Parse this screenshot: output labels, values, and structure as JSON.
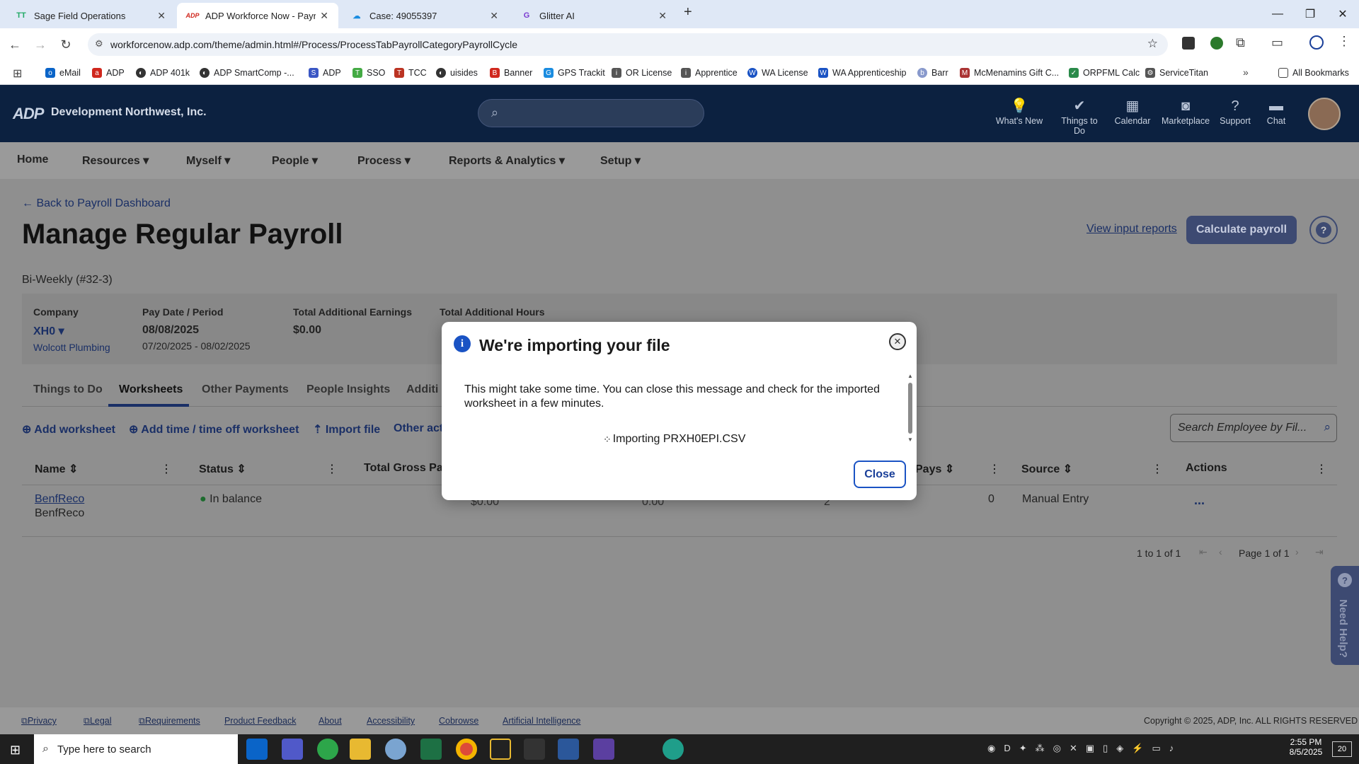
{
  "browser": {
    "tabs": [
      {
        "title": "Sage Field Operations",
        "icon": "TT"
      },
      {
        "title": "ADP Workforce Now - Payroll D",
        "icon": "ADP"
      },
      {
        "title": "Case: 49055397",
        "icon": "cloud"
      },
      {
        "title": "Glitter AI",
        "icon": "G"
      }
    ],
    "url": "workforcenow.adp.com/theme/admin.html#/Process/ProcessTabPayrollCategoryPayrollCycle",
    "bookmarks": [
      "eMail",
      "ADP",
      "ADP 401k",
      "ADP SmartComp -...",
      "ADP",
      "SSO",
      "TCC",
      "uisides",
      "Banner",
      "GPS Trackit",
      "OR License",
      "Apprentice",
      "WA License",
      "WA Apprenticeship",
      "Barr",
      "McMenamins Gift C...",
      "ORPFML Calc",
      "ServiceTitan"
    ],
    "all_bookmarks": "All Bookmarks"
  },
  "header": {
    "logo": "ADP",
    "org": "Development Northwest, Inc.",
    "icons": [
      {
        "label": "What's New",
        "icon": "lightbulb-icon"
      },
      {
        "label": "Things to Do",
        "icon": "check-icon"
      },
      {
        "label": "Calendar",
        "icon": "calendar-icon"
      },
      {
        "label": "Marketplace",
        "icon": "bag-icon"
      },
      {
        "label": "Support",
        "icon": "help-icon"
      },
      {
        "label": "Chat",
        "icon": "chat-icon"
      }
    ]
  },
  "menu": [
    "Home",
    "Resources",
    "Myself",
    "People",
    "Process",
    "Reports & Analytics",
    "Setup"
  ],
  "page": {
    "back": "Back to Payroll Dashboard",
    "title": "Manage Regular Payroll",
    "view_input_reports": "View input reports",
    "calculate": "Calculate payroll",
    "cycle": "Bi-Weekly (#32-3)",
    "summary": {
      "company_label": "Company",
      "company": "XH0",
      "company_name": "Wolcott Plumbing",
      "pay_label": "Pay Date / Period",
      "pay_date": "08/08/2025",
      "period": "07/20/2025 - 08/02/2025",
      "earnings_label": "Total Additional Earnings",
      "earnings": "$0.00",
      "hours_label": "Total Additional Hours"
    },
    "tabs": [
      "Things to Do",
      "Worksheets",
      "Other Payments",
      "People Insights",
      "Additi"
    ],
    "actions": [
      "Add worksheet",
      "Add time / time off worksheet",
      "Import file",
      "Other act"
    ],
    "search_placeholder": "Search Employee by Fil...",
    "columns": [
      "Name",
      "Status",
      "Total Gross Pay",
      "Pays",
      "Source",
      "Actions"
    ],
    "row": {
      "name": "BenfReco",
      "sub": "BenfReco",
      "status": "In balance",
      "gross": "$0.00",
      "hours": "0.00",
      "count": "2",
      "pays": "0",
      "source": "Manual Entry",
      "more": "..."
    },
    "pager": {
      "range": "1 to 1 of 1",
      "page": "Page 1 of 1"
    },
    "need_help": "Need Help?"
  },
  "dialog": {
    "title": "We're importing your file",
    "message": "This might take some time. You can close this message and check for the imported worksheet in a few minutes.",
    "importing": "Importing PRXH0EPI.CSV",
    "close": "Close"
  },
  "footer": {
    "links": [
      "Privacy",
      "Legal",
      "Requirements",
      "Product Feedback",
      "About",
      "Accessibility",
      "Cobrowse",
      "Artificial Intelligence"
    ],
    "copyright": "Copyright © 2025, ADP, Inc. ALL RIGHTS RESERVED"
  },
  "taskbar": {
    "search": "Type here to search",
    "time": "2:55 PM",
    "date": "8/5/2025",
    "notif": "20"
  }
}
